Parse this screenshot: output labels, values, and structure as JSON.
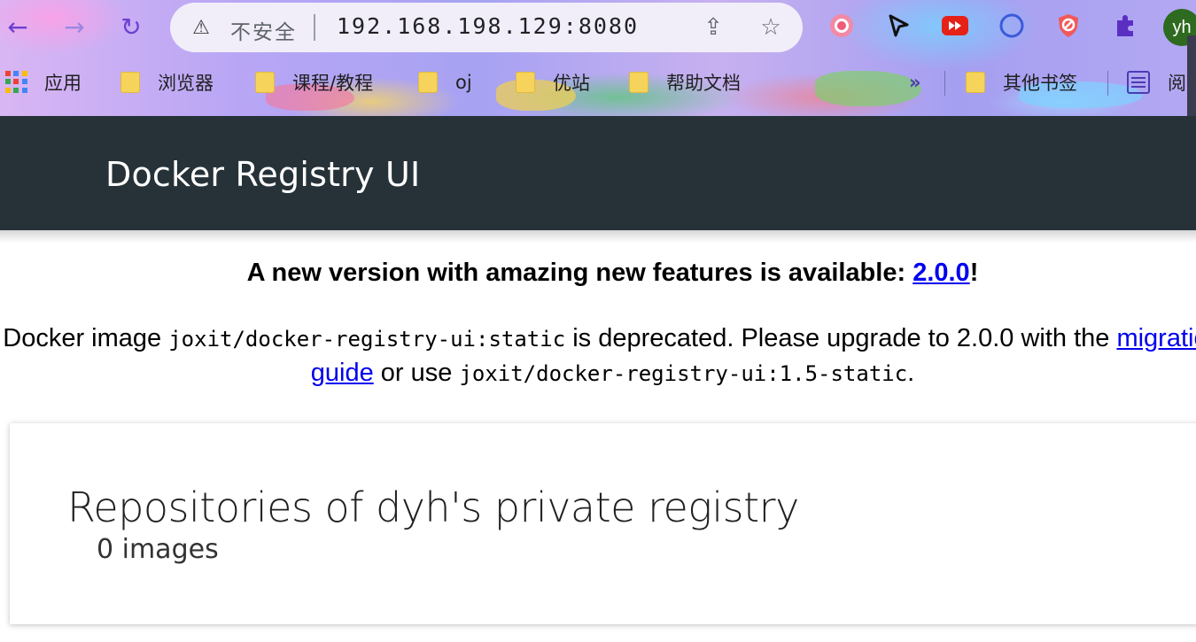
{
  "browser": {
    "insecure_label": "不安全",
    "url": "192.168.198.129:8080",
    "profile_initials": "yh",
    "accent_color": "#6d3fd1"
  },
  "bookmarks": {
    "apps": "应用",
    "items": [
      "浏览器",
      "课程/教程",
      "oj",
      "优站",
      "帮助文档"
    ],
    "more": "»",
    "other": "其他书签",
    "reading": "阅"
  },
  "app": {
    "title": "Docker Registry UI",
    "header_color": "#263238"
  },
  "notice": {
    "line1_prefix": "A new version with amazing new features is available: ",
    "version_link": "2.0.0",
    "line1_suffix": "!",
    "line2_part1": "Docker image ",
    "image_old": "joxit/docker-registry-ui:static",
    "line2_part2": " is deprecated. Please upgrade to 2.0.0 with the ",
    "migration_link": "migration guide",
    "line2_part3": " or use ",
    "image_alt": "joxit/docker-registry-ui:1.5-static",
    "line2_end": "."
  },
  "registry": {
    "title": "Repositories of dyh's private registry",
    "count_label": "0 images"
  }
}
